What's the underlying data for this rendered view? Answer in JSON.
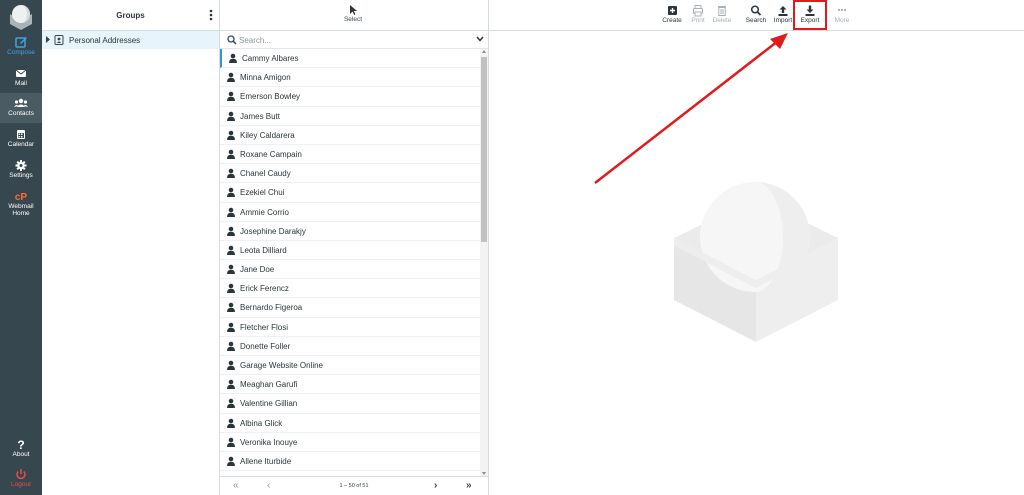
{
  "nav": {
    "items": [
      {
        "label": "Compose",
        "icon": "compose-icon"
      },
      {
        "label": "Mail",
        "icon": "mail-icon"
      },
      {
        "label": "Contacts",
        "icon": "contacts-icon"
      },
      {
        "label": "Calendar",
        "icon": "calendar-icon"
      },
      {
        "label": "Settings",
        "icon": "gear-icon"
      },
      {
        "label_line1": "Webmail",
        "label_line2": "Home",
        "icon": "cpanel-icon"
      },
      {
        "label": "About",
        "icon": "question-icon"
      },
      {
        "label": "Logout",
        "icon": "power-icon"
      }
    ]
  },
  "groups": {
    "title": "Groups",
    "items": [
      {
        "label": "Personal Addresses"
      }
    ]
  },
  "list": {
    "select_label": "Select",
    "search_placeholder": "Search...",
    "contacts": [
      "Cammy Albares",
      "Minna Amigon",
      "Emerson Bowley",
      "James Butt",
      "Kiley Caldarera",
      "Roxane Campain",
      "Chanel Caudy",
      "Ezekiel Chui",
      "Ammie Corrio",
      "Josephine Darakjy",
      "Leota Dilliard",
      "Jane Doe",
      "Erick Ferencz",
      "Bernardo Figeroa",
      "Fletcher Flosi",
      "Donette Foller",
      "Garage Website Online",
      "Meaghan Garufi",
      "Valentine Gillian",
      "Albina Glick",
      "Veronika Inouye",
      "Allene Iturbide"
    ],
    "pager": {
      "count": "1 – 50 of 51",
      "first": "«",
      "prev": "‹",
      "next": "›",
      "last": "»"
    }
  },
  "toolbar": {
    "create": "Create",
    "print": "Print",
    "delete": "Delete",
    "search": "Search",
    "import": "Import",
    "export": "Export",
    "more": "More"
  },
  "colors": {
    "nav_bg": "#37474f",
    "accent_blue": "#2f98d3",
    "annotation_red": "#e01b1b",
    "logout_red": "#ef4a4a"
  }
}
